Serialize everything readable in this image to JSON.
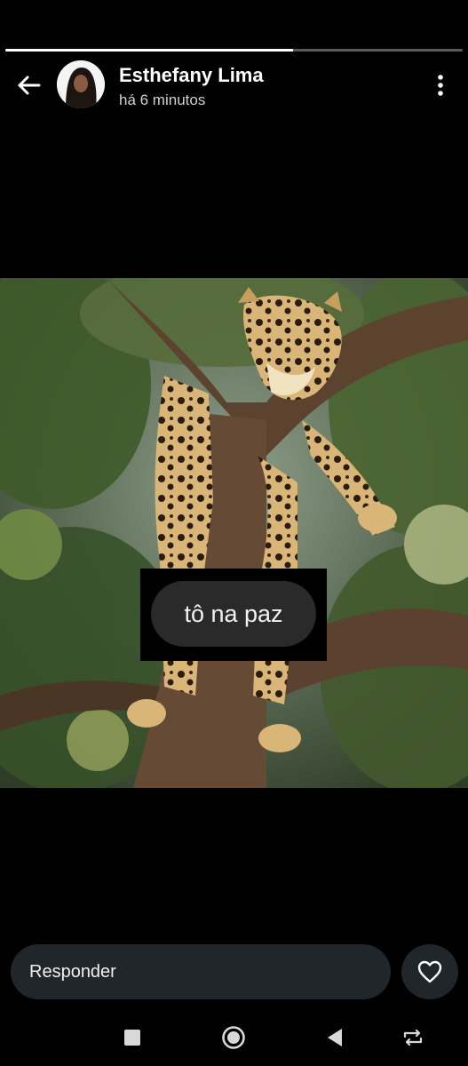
{
  "story": {
    "progress": 0.63,
    "user_name": "Esthefany Lima",
    "timestamp": "há 6 minutos",
    "caption": "tô na paz"
  },
  "reply": {
    "placeholder": "Responder"
  },
  "icons": {
    "back": "arrow-left-icon",
    "more": "more-vertical-icon",
    "like": "heart-icon",
    "nav": [
      "square-icon",
      "home-circle-icon",
      "back-triangle-icon",
      "rotate-icon"
    ]
  }
}
